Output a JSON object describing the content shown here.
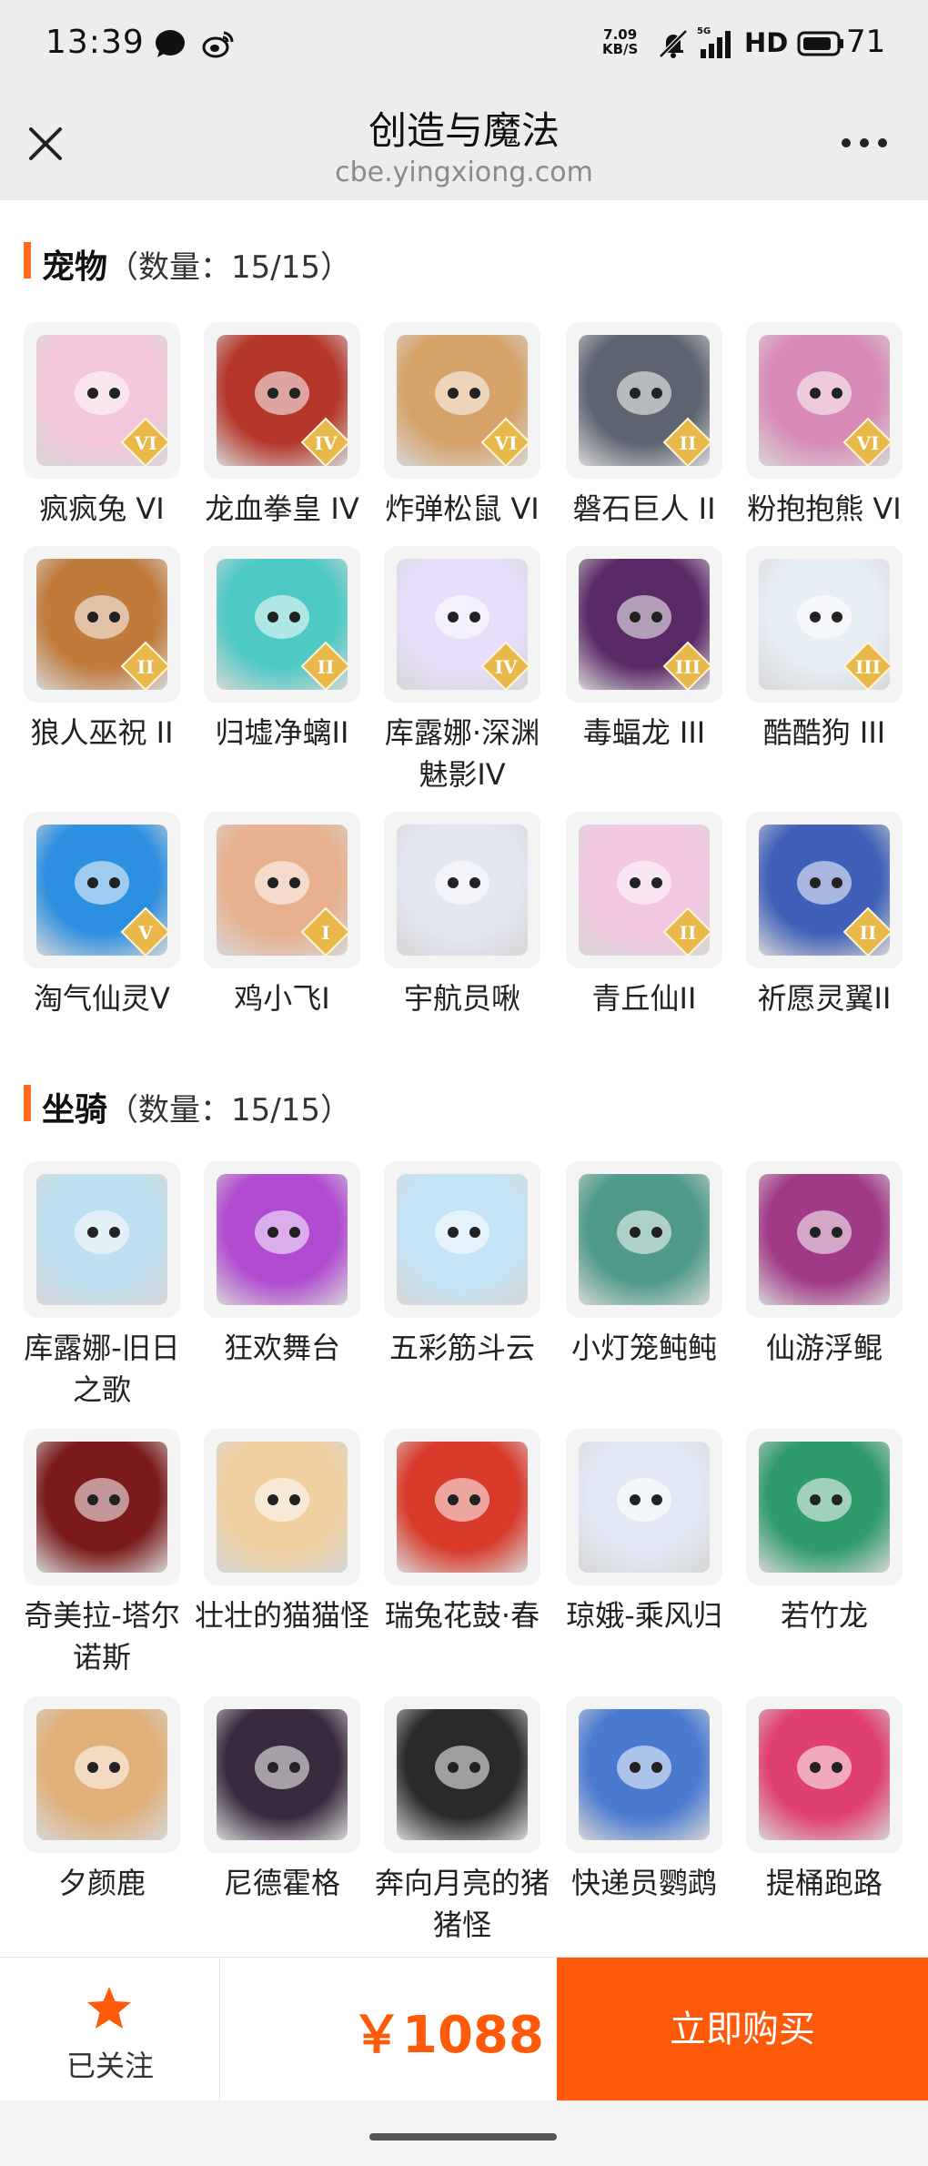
{
  "status_bar": {
    "time": "13:39",
    "net_speed_value": "7.09",
    "net_speed_unit": "KB/S",
    "network": "5G",
    "hd": "HD",
    "battery": "71"
  },
  "nav": {
    "title": "创造与魔法",
    "subtitle": "cbe.yingxiong.com",
    "close_icon": "close-icon",
    "more_icon": "more-icon"
  },
  "pets": {
    "title": "宠物",
    "count": "（数量：15/15）",
    "items": [
      {
        "label": "疯疯兔 VI",
        "color": "#f4c7dc",
        "rank": "VI"
      },
      {
        "label": "龙血拳皇 IV",
        "color": "#b5372b",
        "rank": "IV"
      },
      {
        "label": "炸弹松鼠 VI",
        "color": "#d6a268",
        "rank": "VI"
      },
      {
        "label": "磐石巨人 II",
        "color": "#5d6470",
        "rank": "II"
      },
      {
        "label": "粉抱抱熊 VI",
        "color": "#d98bb8",
        "rank": "VI"
      },
      {
        "label": "狼人巫祝 II",
        "color": "#c07a3c",
        "rank": "II"
      },
      {
        "label": "归墟净螭II",
        "color": "#4fc9c4",
        "rank": "II"
      },
      {
        "label": "库露娜·深渊魅影IV",
        "color": "#e7defa",
        "rank": "IV"
      },
      {
        "label": "毒蝠龙 III",
        "color": "#5a2a66",
        "rank": "III"
      },
      {
        "label": "酷酷狗 III",
        "color": "#e8eef6",
        "rank": "III"
      },
      {
        "label": "淘气仙灵V",
        "color": "#2d8fe0",
        "rank": "V"
      },
      {
        "label": "鸡小飞I",
        "color": "#e8b08e",
        "rank": "I"
      },
      {
        "label": "宇航员啾",
        "color": "#e4e6f2",
        "rank": ""
      },
      {
        "label": "青丘仙II",
        "color": "#f2c8e2",
        "rank": "II"
      },
      {
        "label": "祈愿灵翼II",
        "color": "#3f5fb8",
        "rank": "II"
      }
    ]
  },
  "mounts": {
    "title": "坐骑",
    "count": "（数量：15/15）",
    "items": [
      {
        "label": "库露娜-旧日之歌",
        "color": "#bfe0f0"
      },
      {
        "label": "狂欢舞台",
        "color": "#b04ad0"
      },
      {
        "label": "五彩筋斗云",
        "color": "#c4e4f6"
      },
      {
        "label": "小灯笼鲀鲀",
        "color": "#4f9a8a"
      },
      {
        "label": "仙游浮鲲",
        "color": "#a03a86"
      },
      {
        "label": "奇美拉-塔尔诺斯",
        "color": "#7a1a1a"
      },
      {
        "label": "壮壮的猫猫怪",
        "color": "#f0d0a0"
      },
      {
        "label": "瑞兔花鼓·春",
        "color": "#d83a2a"
      },
      {
        "label": "琼娥-乘风归",
        "color": "#e2e8f4"
      },
      {
        "label": "若竹龙",
        "color": "#2f9a6a"
      },
      {
        "label": "夕颜鹿",
        "color": "#e0b078"
      },
      {
        "label": "尼德霍格",
        "color": "#3a2a3e"
      },
      {
        "label": "奔向月亮的猪猪怪",
        "color": "#2a2a2a"
      },
      {
        "label": "快递员鹦鹉",
        "color": "#4a7ad0"
      },
      {
        "label": "提桶跑路",
        "color": "#e04070"
      }
    ]
  },
  "bottom": {
    "follow_label": "已关注",
    "price": "￥1088",
    "buy_label": "立即购买"
  },
  "colors": {
    "accent": "#ff5a0a",
    "section_bar": "#ff6a1a",
    "rank_badge": "#e8b84a"
  }
}
